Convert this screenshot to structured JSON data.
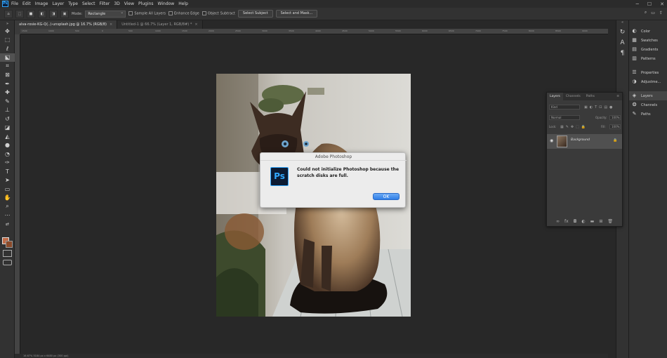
{
  "menubar": {
    "logo": "Ps",
    "items": [
      "File",
      "Edit",
      "Image",
      "Layer",
      "Type",
      "Select",
      "Filter",
      "3D",
      "View",
      "Plugins",
      "Window",
      "Help"
    ],
    "window_controls": [
      "─",
      "☐",
      "✕"
    ]
  },
  "options": {
    "mode_label": "Mode:",
    "mode_value": "Rectangle",
    "sample_all_layers": "Sample All Layers",
    "enhance_edge": "Enhance Edge",
    "object_subtract": "Object Subtract",
    "select_subject": "Select Subject",
    "select_and_mask": "Select and Mask..."
  },
  "tabs": [
    {
      "label": "alva-rosie-KG-Q(..)-unsplash.jpg @ 16.7% (RGB/8)",
      "active": true
    },
    {
      "label": "Untitled-1 @ 66.7% (Layer 1, RGB/8#) *",
      "active": false
    }
  ],
  "ruler_ticks": [
    "1500",
    "1000",
    "500",
    "0",
    "500",
    "1000",
    "1500",
    "2000",
    "2500",
    "3000",
    "3500",
    "4000",
    "4500",
    "5000",
    "5500",
    "6000",
    "6500",
    "7000",
    "7500",
    "8000",
    "8500",
    "9000"
  ],
  "dialog": {
    "title": "Adobe Photoshop",
    "icon": "Ps",
    "message": "Could not initialize Photoshop because the scratch disks are full.",
    "ok": "OK"
  },
  "dock": {
    "group1": [
      {
        "icon": "color-icon",
        "glyph": "◐",
        "label": "Color"
      },
      {
        "icon": "swatches-icon",
        "glyph": "▦",
        "label": "Swatches"
      },
      {
        "icon": "gradients-icon",
        "glyph": "▤",
        "label": "Gradients"
      },
      {
        "icon": "patterns-icon",
        "glyph": "▥",
        "label": "Patterns"
      }
    ],
    "group2": [
      {
        "icon": "properties-icon",
        "glyph": "☰",
        "label": "Properties"
      },
      {
        "icon": "adjustments-icon",
        "glyph": "◑",
        "label": "Adjustme..."
      }
    ],
    "group3": [
      {
        "icon": "layers-icon",
        "glyph": "◈",
        "label": "Layers",
        "active": true
      },
      {
        "icon": "channels-icon",
        "glyph": "❂",
        "label": "Channels"
      },
      {
        "icon": "paths-icon",
        "glyph": "✎",
        "label": "Paths"
      }
    ]
  },
  "layers_panel": {
    "tabs": [
      "Layers",
      "Channels",
      "Paths"
    ],
    "kind": "Kind",
    "blend_mode": "Normal",
    "opacity_label": "Opacity:",
    "opacity_value": "100%",
    "lock_label": "Lock:",
    "fill_label": "Fill:",
    "fill_value": "100%",
    "layer_name": "Background"
  },
  "status": "16.67%    5184 px x 6480 px (300 ppi)"
}
